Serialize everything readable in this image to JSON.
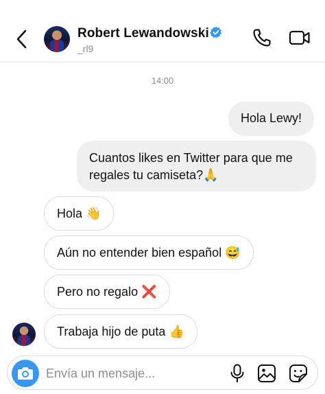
{
  "header": {
    "name": "Robert Lewandowski",
    "username": "_rl9",
    "verified": true
  },
  "thread": {
    "timestamp": "14:00",
    "messages": [
      {
        "side": "outgoing",
        "text": "Hola Lewy!"
      },
      {
        "side": "outgoing",
        "text": "Cuantos likes en Twitter para que me regales tu camiseta?🙏"
      },
      {
        "side": "incoming",
        "text": "Hola 👋"
      },
      {
        "side": "incoming",
        "text": "Aún no entender bien español 😅"
      },
      {
        "side": "incoming",
        "text": "Pero no regalo ❌"
      },
      {
        "side": "incoming",
        "text": "Trabaja hijo de puta 👍"
      }
    ]
  },
  "composer": {
    "placeholder": "Envía un mensaje..."
  },
  "colors": {
    "accent": "#3897f0",
    "outgoing_bubble": "#efefef",
    "verified_badge": "#3897f0"
  },
  "icons": [
    "chevron-left-icon",
    "verified-icon",
    "phone-icon",
    "video-camera-icon",
    "camera-icon",
    "microphone-icon",
    "image-icon",
    "sticker-icon"
  ]
}
